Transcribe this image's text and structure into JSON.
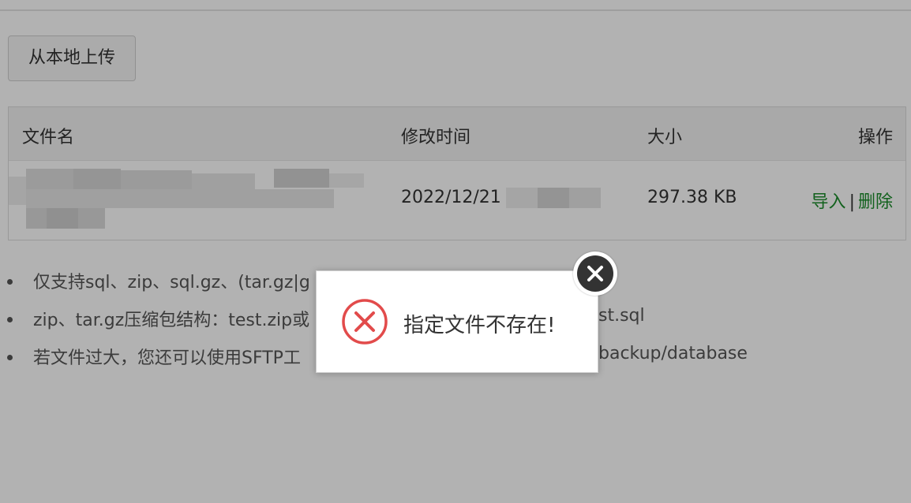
{
  "toolbar": {
    "upload_label": "从本地上传"
  },
  "table": {
    "headers": {
      "name": "文件名",
      "modified": "修改时间",
      "size": "大小",
      "actions": "操作"
    },
    "rows": [
      {
        "modified_visible": "2022/12/21",
        "size": "297.38 KB",
        "import_label": "导入",
        "separator": "|",
        "delete_label": "删除"
      }
    ]
  },
  "tips": [
    "仅支持sql、zip、sql.gz、(tar.gz|g",
    "zip、tar.gz压缩包结构：test.zip或",
    "若文件过大，您还可以使用SFTP工"
  ],
  "tips_tail": [
    "",
    "st.sql",
    "backup/database"
  ],
  "dialog": {
    "message": "指定文件不存在!"
  },
  "colors": {
    "link": "#1a8c2a",
    "error": "#e24b4b"
  }
}
